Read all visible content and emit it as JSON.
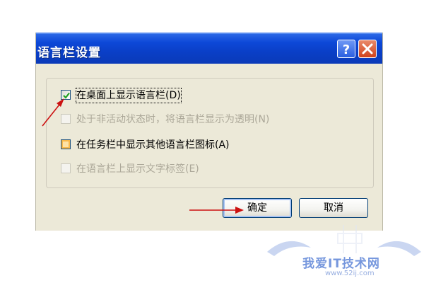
{
  "dialog": {
    "title": "语言栏设置",
    "help_icon": "question-mark-icon",
    "close_icon": "close-x-icon"
  },
  "options": [
    {
      "label": "在桌面上显示语言栏(D)",
      "checked": true,
      "enabled": true
    },
    {
      "label": "处于非活动状态时，将语言栏显示为透明(N)",
      "checked": false,
      "enabled": false
    },
    {
      "label": "在任务栏中显示其他语言栏图标(A)",
      "checked": false,
      "enabled": true
    },
    {
      "label": "在语言栏上显示文字标签(E)",
      "checked": false,
      "enabled": false
    }
  ],
  "buttons": {
    "ok_label": "确定",
    "cancel_label": "取消"
  },
  "watermark": {
    "site_name": "我爱IT技术网",
    "url": "www.52ij.com"
  },
  "colors": {
    "titlebar": "#0a3fc7",
    "dialog_bg": "#ece9d8",
    "annotation_arrow": "#cc1111",
    "watermark": "#5f86d8"
  }
}
